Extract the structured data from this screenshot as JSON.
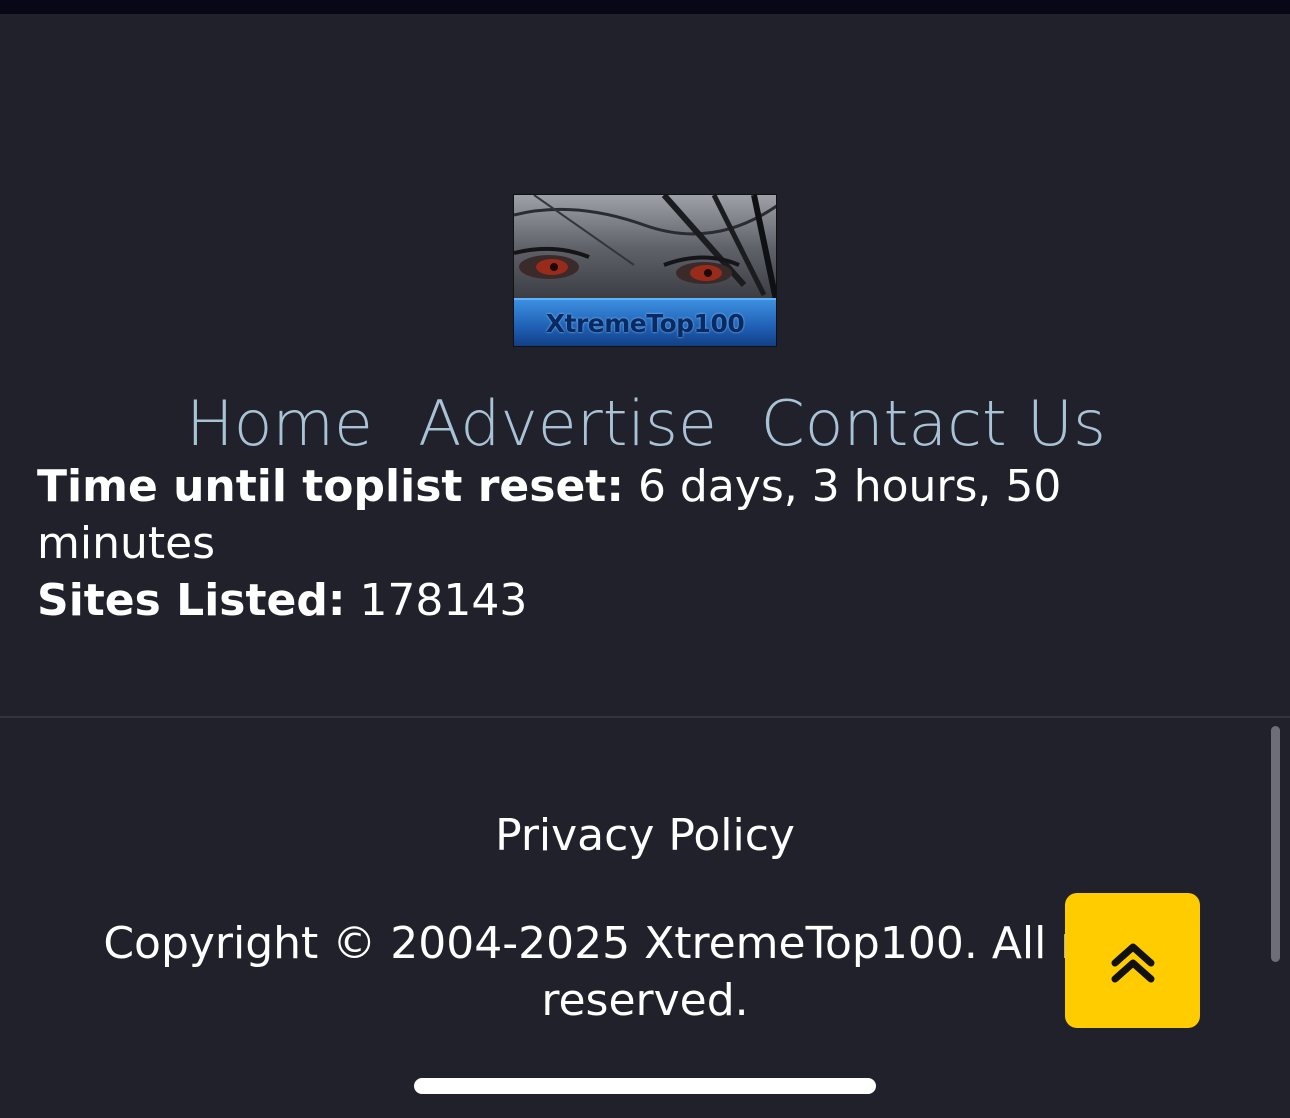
{
  "logo": {
    "text": "XtremeTop100"
  },
  "nav": {
    "items": [
      {
        "label": "Home"
      },
      {
        "label": "Advertise"
      },
      {
        "label": "Contact Us"
      }
    ]
  },
  "stats": {
    "reset_label": "Time until toplist reset:",
    "reset_value": "6 days, 3 hours, 50 minutes",
    "sites_label": "Sites Listed:",
    "sites_value": "178143"
  },
  "footer": {
    "privacy_label": "Privacy Policy",
    "copyright": "Copyright © 2004-2025 XtremeTop100. All rights reserved."
  },
  "scroll_top": {
    "icon": "double-chevron-up-icon",
    "color": "#ffcc00"
  },
  "colors": {
    "background": "#21212b",
    "nav_link": "#a9c3d6"
  }
}
